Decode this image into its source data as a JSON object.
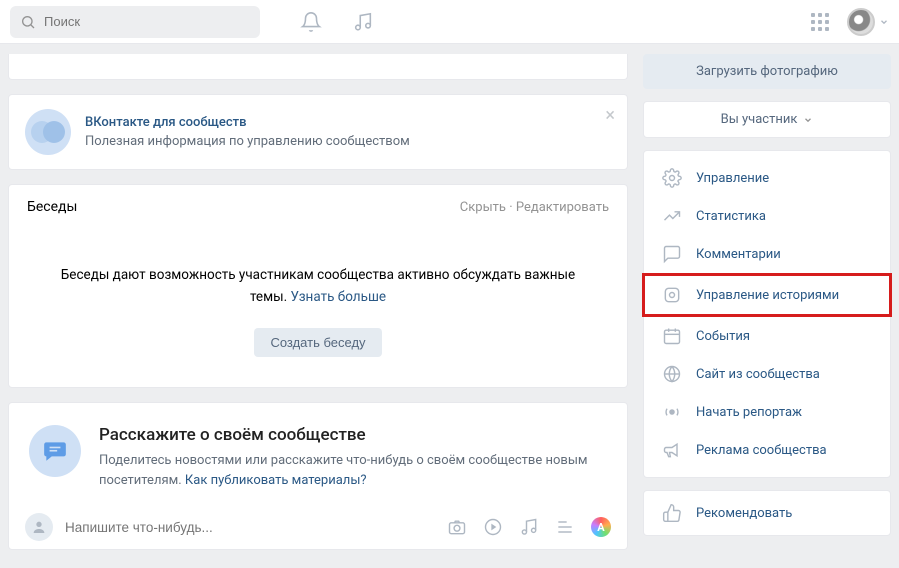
{
  "search": {
    "placeholder": "Поиск"
  },
  "promo": {
    "title": "ВКонтакте для сообществ",
    "subtitle": "Полезная информация по управлению сообществом"
  },
  "conversations": {
    "title": "Беседы",
    "hide": "Скрыть",
    "edit": "Редактировать",
    "separator": " · ",
    "body": "Беседы дают возможность участникам сообщества активно обсуждать важные темы. ",
    "learn_more": "Узнать больше",
    "create": "Создать беседу"
  },
  "about": {
    "title": "Расскажите о своём сообществе",
    "subtitle_1": "Поделитесь новостями или расскажите что-нибудь о своём сообществе новым посетителям. ",
    "how_link": "Как публиковать материалы?"
  },
  "compose": {
    "placeholder": "Напишите что-нибудь..."
  },
  "side": {
    "upload": "Загрузить фотографию",
    "member": "Вы участник",
    "menu": [
      {
        "label": "Управление"
      },
      {
        "label": "Статистика"
      },
      {
        "label": "Комментарии"
      },
      {
        "label": "Управление историями"
      },
      {
        "label": "События"
      },
      {
        "label": "Сайт из сообщества"
      },
      {
        "label": "Начать репортаж"
      },
      {
        "label": "Реклама сообщества"
      }
    ],
    "recommend": "Рекомендовать"
  }
}
